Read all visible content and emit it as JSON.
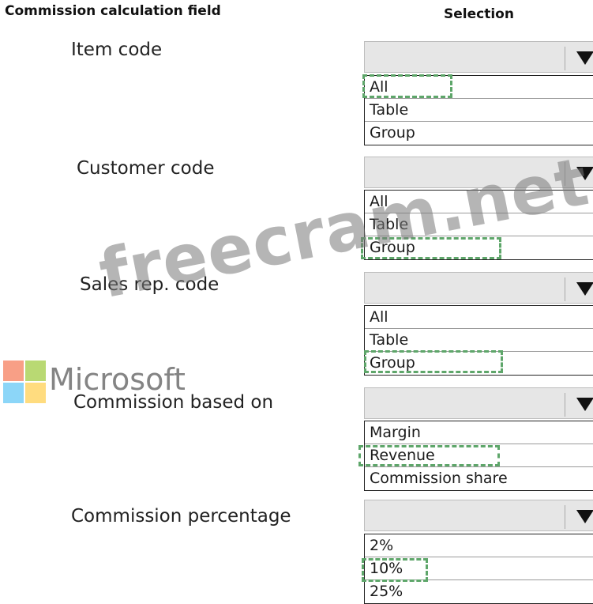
{
  "headers": {
    "field": "Commission calculation field",
    "selection": "Selection"
  },
  "rows": [
    {
      "label": "Item code",
      "options": [
        "All",
        "Table",
        "Group"
      ],
      "selected": "All"
    },
    {
      "label": "Customer code",
      "options": [
        "All",
        "Table",
        "Group"
      ],
      "selected": "Group"
    },
    {
      "label": "Sales rep. code",
      "options": [
        "All",
        "Table",
        "Group"
      ],
      "selected": "Group"
    },
    {
      "label": "Commission based on",
      "options": [
        "Margin",
        "Revenue",
        "Commission share"
      ],
      "selected": "Revenue"
    },
    {
      "label": "Commission percentage",
      "options": [
        "2%",
        "10%",
        "25%"
      ],
      "selected": "10%"
    }
  ],
  "watermark": {
    "site": "freecram.net",
    "brand": "Microsoft"
  },
  "colors": {
    "selection_marker": "#5ea66a",
    "combo_background": "#e6e6e6",
    "logo_red": "#f25022",
    "logo_green": "#7fba00",
    "logo_blue": "#00a4ef",
    "logo_yellow": "#ffb900"
  },
  "icons": {
    "dropdown": "triangle-down-icon"
  }
}
